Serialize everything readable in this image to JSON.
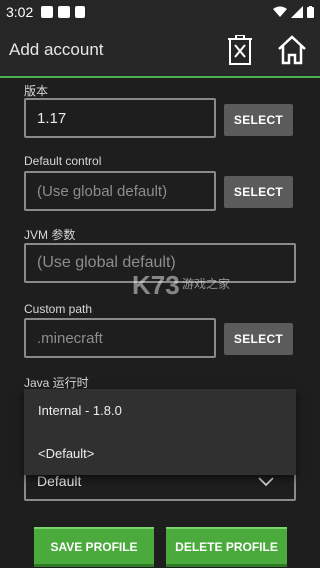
{
  "status_bar": {
    "time": "3:02"
  },
  "app_bar": {
    "title": "Add account"
  },
  "form": {
    "version_label": "版本",
    "version_value": "1.17",
    "default_control_label": "Default control",
    "default_control_placeholder": "(Use global default)",
    "jvm_label": "JVM 参数",
    "jvm_placeholder": "(Use global default)",
    "custom_path_label": "Custom path",
    "custom_path_placeholder": ".minecraft",
    "java_runtime_label": "Java 运行时",
    "java_runtime_selected": "Default",
    "select_label": "SELECT"
  },
  "dropdown": {
    "options": [
      "Internal - 1.8.0",
      "<Default>"
    ]
  },
  "buttons": {
    "save": "SAVE PROFILE",
    "delete": "DELETE PROFILE"
  },
  "watermark": {
    "logo": "K73",
    "text": "游戏之家"
  },
  "colors": {
    "accent": "#4caf50",
    "button_green": "#4aab3c",
    "field_border": "#8a8a8a"
  }
}
